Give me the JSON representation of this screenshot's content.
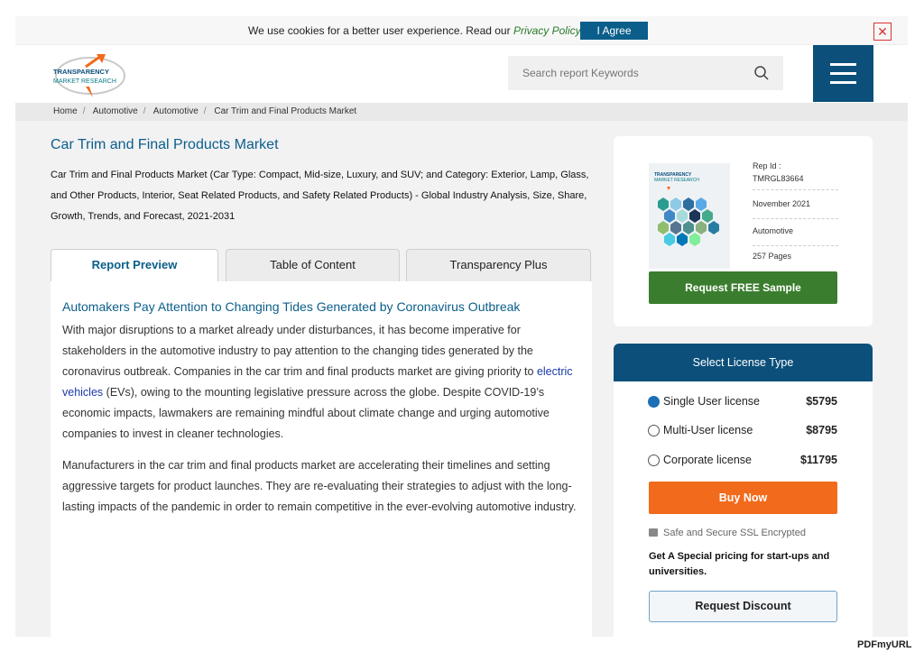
{
  "cookie": {
    "text_prefix": "We use cookies for a better user experience. Read our",
    "policy_link": "Privacy Policy",
    "agree_label": "I Agree",
    "close_icon": "close-icon"
  },
  "logo": {
    "line1": "TRANSPARENCY",
    "line2": "MARKET RESEARCH"
  },
  "search": {
    "placeholder": "Search report Keywords",
    "icon": "search-icon"
  },
  "breadcrumb": [
    "Home",
    "Automotive",
    "Automotive",
    "Car Trim and Final Products Market"
  ],
  "report": {
    "title": "Car Trim and Final Products Market",
    "subtitle": "Car Trim and Final Products Market (Car Type: Compact, Mid-size, Luxury, and SUV; and Category: Exterior, Lamp, Glass, and Other Products, Interior, Seat Related Products, and Safety Related Products) - Global Industry Analysis, Size, Share, Growth, Trends, and Forecast, 2021-2031"
  },
  "tabs": [
    {
      "label": "Report Preview"
    },
    {
      "label": "Table of Content"
    },
    {
      "label": "Transparency Plus"
    }
  ],
  "content": {
    "heading": "Automakers Pay Attention to Changing Tides Generated by Coronavirus Outbreak",
    "p1_before": "With major disruptions to a market already under disturbances, it has become imperative for stakeholders in the automotive industry to pay attention to the changing tides generated by the coronavirus outbreak. Companies in the car trim and final products market are giving priority to",
    "p1_link": "electric vehicles",
    "p1_after": "(EVs), owing to the mounting legislative pressure across the globe. Despite COVID-19’s economic impacts, lawmakers are remaining mindful about climate change and urging automotive companies to invest in cleaner technologies.",
    "p2": "Manufacturers in the car trim and final products market are accelerating their timelines and setting aggressive targets for product launches. They are re-evaluating their strategies to adjust with the long-lasting impacts of the pandemic in order to remain competitive in the ever-evolving automotive industry."
  },
  "card": {
    "rep_id_label": "Rep Id :",
    "rep_id": "TMRGL83664",
    "date": "November 2021",
    "category": "Automotive",
    "pages": "257 Pages",
    "sample_label": "Request FREE Sample"
  },
  "license": {
    "heading": "Select License Type",
    "options": [
      {
        "label": "Single User license",
        "price": "$5795",
        "selected": true
      },
      {
        "label": "Multi-User license",
        "price": "$8795",
        "selected": false
      },
      {
        "label": "Corporate license",
        "price": "$11795",
        "selected": false
      }
    ],
    "buy_label": "Buy Now",
    "ssl_text": "Safe and Secure SSL Encrypted",
    "special_text": "Get A Special pricing for start-ups and universities.",
    "discount_label": "Request Discount"
  },
  "watermark": "PDFmyURL",
  "colors": {
    "brand_blue": "#0b4f7a",
    "title_blue": "#0b5e8a",
    "sample_green": "#3a7d2e",
    "buy_orange": "#f26a1b"
  }
}
